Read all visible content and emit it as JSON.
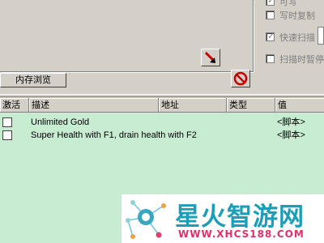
{
  "options": [
    {
      "label": "可写",
      "checked": true
    },
    {
      "label": "写时复制",
      "checked": false
    },
    {
      "label": "快速扫描",
      "checked": true
    },
    {
      "label": "扫描时暂停",
      "checked": false
    }
  ],
  "buttons": {
    "memory_view": "内存浏览"
  },
  "table": {
    "columns": [
      "激活",
      "描述",
      "地址",
      "类型",
      "值"
    ],
    "rows": [
      {
        "active": false,
        "description": "Unlimited Gold",
        "address": "",
        "type": "",
        "value": "<脚本>"
      },
      {
        "active": false,
        "description": "Super Health with F1, drain health with F2",
        "address": "",
        "type": "",
        "value": "<脚本>"
      }
    ]
  },
  "watermark": {
    "title": "星火智游网",
    "url": "WWW.XHCS188.COM"
  },
  "colors": {
    "window_bg": "#d4d0c8",
    "list_bg": "#c8ecd2",
    "accent_red": "#cc0000"
  }
}
